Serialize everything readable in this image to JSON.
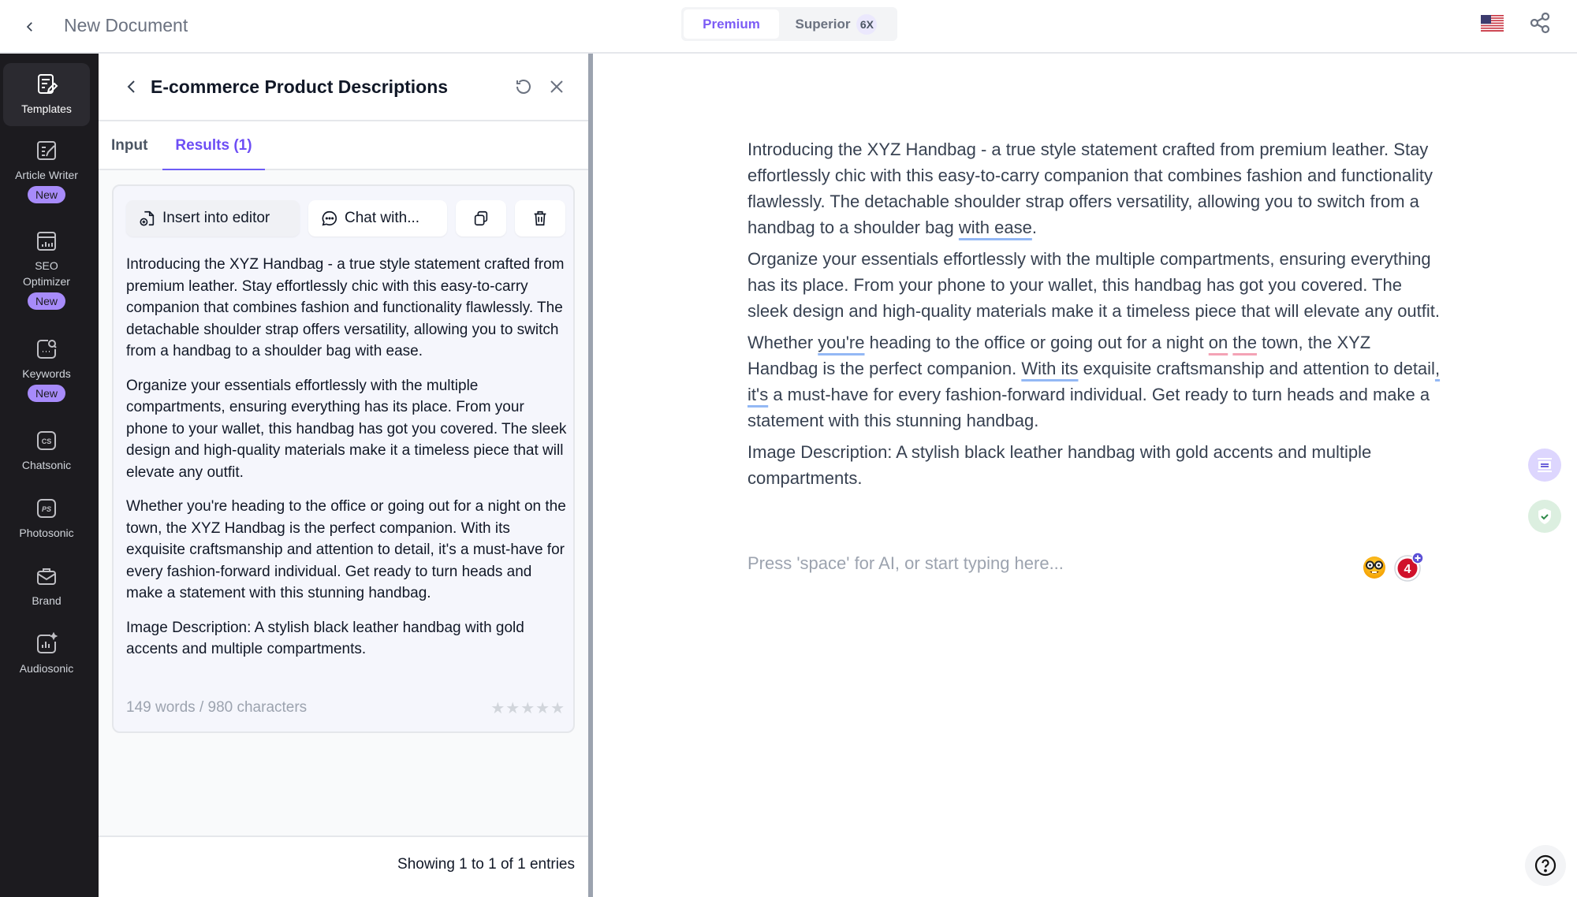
{
  "topbar": {
    "document_title": "New Document",
    "modes": [
      {
        "label": "Premium",
        "selected": true
      },
      {
        "label": "Superior",
        "badge": "6X",
        "selected": false
      }
    ],
    "language_flag": "us-flag-icon",
    "share_icon": "share-icon"
  },
  "sidebar": {
    "items": [
      {
        "label": "Templates",
        "icon": "templates-icon",
        "active": true
      },
      {
        "label": "Article Writer",
        "icon": "article-writer-icon",
        "badge": "New"
      },
      {
        "label": "SEO Optimizer",
        "icon": "seo-optimizer-icon",
        "badge": "New"
      },
      {
        "label": "Keywords",
        "icon": "keywords-icon",
        "badge": "New"
      },
      {
        "label": "Chatsonic",
        "icon": "chatsonic-icon",
        "icon_text": "CS"
      },
      {
        "label": "Photosonic",
        "icon": "photosonic-icon",
        "icon_text": "PS"
      },
      {
        "label": "Brand",
        "icon": "brand-icon"
      },
      {
        "label": "Audiosonic",
        "icon": "audiosonic-icon"
      }
    ]
  },
  "panel": {
    "title": "E-commerce Product Descriptions",
    "tabs": [
      {
        "label": "Input",
        "active": false
      },
      {
        "label": "Results (1)",
        "active": true
      }
    ],
    "result": {
      "actions": {
        "insert": "Insert into editor",
        "chat": "Chat with..."
      },
      "paragraphs": [
        "Introducing the XYZ Handbag - a true style statement crafted from premium leather. Stay effortlessly chic with this easy-to-carry companion that combines fashion and functionality flawlessly. The detachable shoulder strap offers versatility, allowing you to switch from a handbag to a shoulder bag with ease.",
        "Organize your essentials effortlessly with the multiple compartments, ensuring everything has its place. From your phone to your wallet, this handbag has got you covered. The sleek design and high-quality materials make it a timeless piece that will elevate any outfit.",
        "Whether you're heading to the office or going out for a night on the town, the XYZ Handbag is the perfect companion. With its exquisite craftsmanship and attention to detail, it's a must-have for every fashion-forward individual. Get ready to turn heads and make a statement with this stunning handbag.",
        "Image Description: A stylish black leather handbag with gold accents and multiple compartments."
      ],
      "count": "149 words / 980 characters",
      "rating": {
        "value": 0,
        "max": 5
      }
    },
    "footer": "Showing 1 to 1 of 1 entries"
  },
  "editor": {
    "p1": {
      "a": "Introducing the XYZ Handbag - a true style statement crafted from premium leather. Stay effortlessly chic with this easy-to-carry companion that combines fashion and functionality flawlessly. The detachable shoulder strap offers versatility, allowing you to switch from a handbag to a shoulder bag ",
      "u1": "with ease",
      "b": "."
    },
    "p2": "Organize your essentials effortlessly with the multiple compartments, ensuring everything has its place. From your phone to your wallet, this handbag has got you covered. The sleek design and high-quality materials make it a timeless piece that will elevate any outfit.",
    "p3": {
      "a": "Whether ",
      "u1": "you're",
      "b": " heading to the office or going out for a night ",
      "r1": "on",
      "c": " ",
      "r2": "the",
      "d": " town, the XYZ Handbag is the perfect companion. ",
      "u2": "With its",
      "e": " exquisite craftsmanship and attention to detail",
      "u3": ", it's",
      "f": " a must-have for every fashion-forward individual. Get ready to turn heads and make a statement with this stunning handbag."
    },
    "p4": "Image Description: A stylish black leather handbag with gold accents and multiple compartments.",
    "placeholder": "Press 'space' for AI, or start typing here...",
    "grammar_issue_count": "4",
    "colors": {
      "accent": "#6d4ef5",
      "badge_red": "#d0112b",
      "badge_plus": "#5b4fd6"
    }
  }
}
